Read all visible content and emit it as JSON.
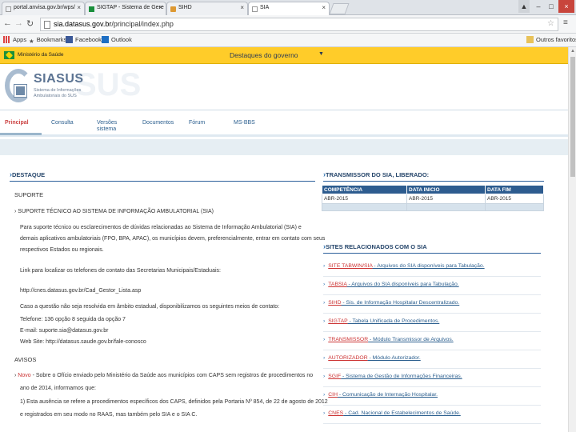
{
  "browser": {
    "tabs": [
      {
        "label": "portal.anvisa.gov.br/wps/",
        "active": false
      },
      {
        "label": "SIGTAP - Sistema de Gere",
        "active": false
      },
      {
        "label": "SIHD",
        "active": false
      },
      {
        "label": "SIA",
        "active": true
      }
    ],
    "url_host": "sia.datasus.gov.br",
    "url_path": "/principal/index.php",
    "bookmarks": [
      "Apps",
      "Bookmarks",
      "Facebook",
      "Outlook"
    ],
    "other_bookmarks": "Outros favoritos"
  },
  "govbar": {
    "ministry": "Ministério da Saúde",
    "destaques": "Destaques do governo"
  },
  "logo": {
    "title": "SIASUS",
    "subtitle": "Sistema de Informações Ambulatoriais do SUS"
  },
  "menu": [
    {
      "label": "Principal",
      "active": true
    },
    {
      "label": "Consulta",
      "active": false
    },
    {
      "label": "Versões sistema",
      "active": false
    },
    {
      "label": "Documentos",
      "active": false
    },
    {
      "label": "Fórum",
      "active": false
    },
    {
      "label": "MS-BBS",
      "active": false
    }
  ],
  "destaque": {
    "heading": "DESTAQUE",
    "suporte_label": "SUPORTE",
    "suporte_title": "SUPORTE TÉCNICO AO SISTEMA DE INFORMAÇÃO AMBULATORIAL (SIA)",
    "p1": [
      "Para suporte técnico ou esclarecimentos de dúvidas relacionadas ao Sistema de Informação Ambulatorial (SIA) e",
      "demais aplicativos ambulatoriais (FPO, BPA, APAC), os municípios devem, preferencialmente, entrar em contato com seus",
      "respectivos Estados ou regionais."
    ],
    "p2": "Link para localizar os telefones de contato das Secretarias Municipais/Estaduais:",
    "p3": "http://cnes.datasus.gov.br/Cad_Gestor_Lista.asp",
    "p4": "Caso a questão não seja resolvida em âmbito estadual, disponibilizamos os seguintes meios de contato:",
    "contacts": [
      "Telefone: 136 opção 8 seguida da opção 7",
      "E-mail: suporte.sia@datasus.gov.br",
      "Web Site: http://datasus.saude.gov.br/fale-conosco"
    ],
    "avisos_label": "AVISOS",
    "aviso_new": "Novo",
    "aviso_lines": [
      " - Sobre o Ofício enviado pelo Ministério da Saúde aos municípios com CAPS sem registros de procedimentos no",
      "ano de 2014, informamos que:",
      "1) Esta ausência se refere a procedimentos específicos dos CAPS, definidos pela Portaria Nº 854, de 22 de agosto de 2012",
      "e registrados em seu modo no RAAS, mas também pelo SIA e o SIA C."
    ]
  },
  "transmissor": {
    "heading": "TRANSMISSOR DO SIA, LIBERADO:",
    "columns": [
      "COMPETÊNCIA",
      "DATA INICIO",
      "DATA FIM"
    ],
    "row": [
      "ABR-2015",
      "ABR-2015",
      "ABR-2015"
    ]
  },
  "sites": {
    "heading": "SITES RELACIONADOS COM O SIA",
    "links": [
      {
        "key": "SITE TABWIN/SIA",
        "desc": " - Arquivos do SIA disponíveis para Tabulação."
      },
      {
        "key": "TABSIA",
        "desc": " - Arquivos do SIA disponíveis para Tabulação."
      },
      {
        "key": "SIHD",
        "desc": " - Sis. de Informação Hospitalar Descentralizado."
      },
      {
        "key": "SIGTAP",
        "desc": " - Tabela Unificada de Procedimentos."
      },
      {
        "key": "TRANSMISSOR",
        "desc": " - Módulo Transmissor de Arquivos."
      },
      {
        "key": "AUTORIZADOR",
        "desc": " - Módulo Autorizador."
      },
      {
        "key": "SGIF",
        "desc": " - Sistema de Gestão de Informações Financeiras."
      },
      {
        "key": "CIH",
        "desc": " - Comunicação de Internação Hospitalar."
      },
      {
        "key": "CNES",
        "desc": " - Cad. Nacional de Estabelecimentos de Saúde."
      }
    ]
  },
  "colors": {
    "govbar": "#ffcc29",
    "header_blue": "#2d5c8f",
    "link_red": "#cc3333",
    "link_blue": "#2a5e8e"
  }
}
